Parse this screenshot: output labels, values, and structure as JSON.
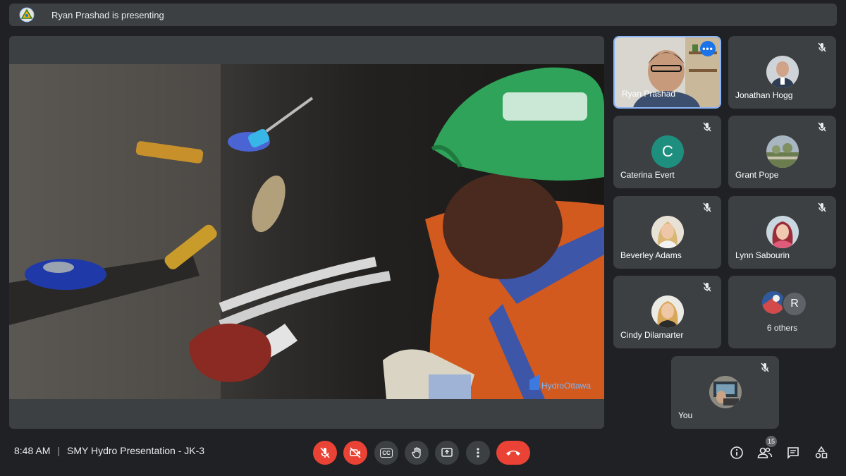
{
  "banner": {
    "text": "Ryan Prashad is presenting"
  },
  "video": {
    "watermark": "HydroOttawa"
  },
  "participants": [
    {
      "name": "Ryan Prashad",
      "muted": false,
      "active": true
    },
    {
      "name": "Jonathan Hogg",
      "muted": true
    },
    {
      "name": "Caterina Evert",
      "muted": true,
      "initial": "C"
    },
    {
      "name": "Grant Pope",
      "muted": true
    },
    {
      "name": "Beverley Adams",
      "muted": true
    },
    {
      "name": "Lynn Sabourin",
      "muted": true
    },
    {
      "name": "Cindy Dilamarter",
      "muted": true
    },
    {
      "name": "6 others",
      "initial": "R"
    },
    {
      "name": "You",
      "muted": true
    }
  ],
  "meeting": {
    "time": "8:48 AM",
    "separator": "|",
    "title": "SMY Hydro Presentation - JK-3"
  },
  "people_count": "15",
  "controls": {
    "mic": "mic-off-icon",
    "camera": "camera-off-icon",
    "captions_label": "CC",
    "hand": "raise-hand-icon",
    "present": "present-screen-icon",
    "more": "more-options-icon",
    "end": "end-call-icon"
  },
  "colors": {
    "danger": "#ea4335",
    "accent": "#1a73e8",
    "tile": "#3c4043",
    "bg": "#202124"
  }
}
